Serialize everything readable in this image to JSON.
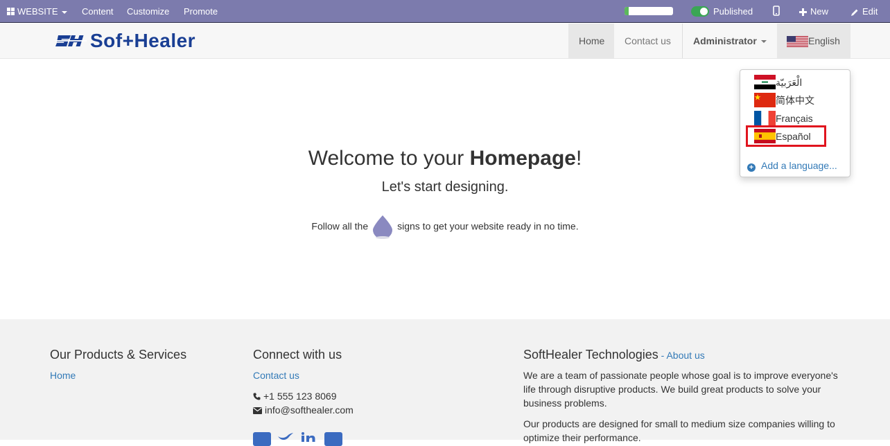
{
  "adminbar": {
    "website_label": "WEBSITE",
    "content_label": "Content",
    "customize_label": "Customize",
    "promote_label": "Promote",
    "seo_progress": 0.08,
    "published_label": "Published",
    "published": true,
    "new_label": "New",
    "edit_label": "Edit"
  },
  "header": {
    "logo_text": "Sof+Healer",
    "nav": {
      "home": "Home",
      "contact": "Contact us",
      "admin": "Administrator",
      "language": "English"
    }
  },
  "language_menu": {
    "items": [
      {
        "label": "الْعَرَبيّة",
        "flag": "iraq-flag-icon"
      },
      {
        "label": "简体中文",
        "flag": "china-flag-icon"
      },
      {
        "label": "Français",
        "flag": "france-flag-icon"
      },
      {
        "label": "Español",
        "flag": "spain-flag-icon"
      }
    ],
    "add_language": "Add a language...",
    "highlight_color": "#e0141e"
  },
  "hero": {
    "title_prefix": "Welcome to your ",
    "title_bold": "Homepage",
    "title_suffix": "!",
    "subtitle": "Let's start designing.",
    "follow_before": "Follow all the",
    "follow_after": "signs to get your website ready in no time."
  },
  "footer": {
    "col1": {
      "heading": "Our Products & Services",
      "link": "Home"
    },
    "col2": {
      "heading": "Connect with us",
      "link": "Contact us",
      "phone": "+1 555 123 8069",
      "email": "info@softhealer.com"
    },
    "col3": {
      "heading": "SoftHealer Technologies",
      "about_sep": " - ",
      "about_link": "About us",
      "para1": "We are a team of passionate people whose goal is to improve everyone's life through disruptive products. We build great products to solve your business problems.",
      "para2": "Our products are designed for small to medium size companies willing to optimize their performance."
    }
  },
  "colors": {
    "adminbar_bg": "#7c7bad",
    "link": "#337ab7",
    "brand": "#1a3f94"
  }
}
